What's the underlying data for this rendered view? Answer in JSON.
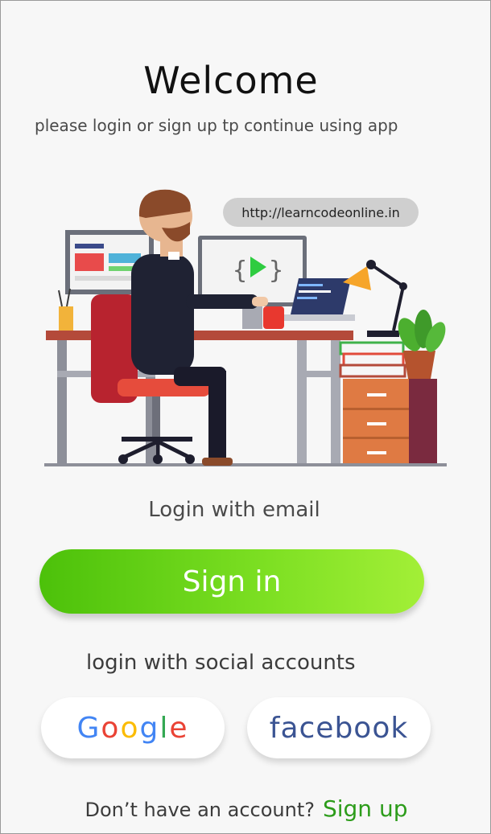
{
  "header": {
    "title": "Welcome",
    "subtitle": "please login or sign up tp continue using app"
  },
  "illustration": {
    "url": "http://learncodeonline.in"
  },
  "email_section": {
    "label": "Login with email",
    "signin_label": "Sign in"
  },
  "social": {
    "label": "login  with social accounts",
    "google": [
      "G",
      "o",
      "o",
      "g",
      "l",
      "e"
    ],
    "facebook_label": "facebook"
  },
  "footer": {
    "prompt": "Don’t have an account?",
    "signup_label": "Sign up"
  },
  "colors": {
    "accent_start": "#4cc10a",
    "accent_end": "#a3ef37",
    "facebook": "#3b5493",
    "signup_link": "#2c9c1a"
  }
}
